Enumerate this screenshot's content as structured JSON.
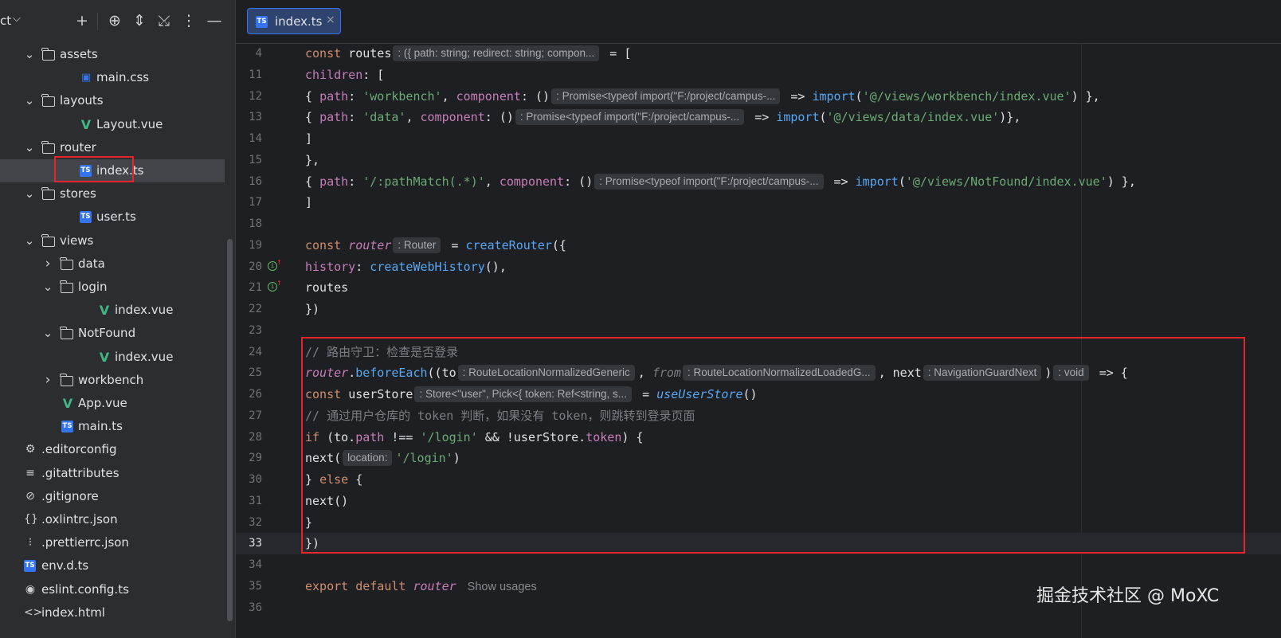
{
  "project_panel": {
    "title": "ct",
    "toolbar_icons": [
      "add-icon",
      "locate-icon",
      "expand-all-icon",
      "collapse-all-icon",
      "more-options-icon",
      "hide-icon"
    ],
    "items": [
      {
        "label": "assets",
        "kind": "folder",
        "depth": 1,
        "expanded": true
      },
      {
        "label": "main.css",
        "kind": "css",
        "depth": 2
      },
      {
        "label": "layouts",
        "kind": "folder",
        "depth": 1,
        "expanded": true
      },
      {
        "label": "Layout.vue",
        "kind": "vue",
        "depth": 2
      },
      {
        "label": "router",
        "kind": "folder",
        "depth": 1,
        "expanded": true
      },
      {
        "label": "index.ts",
        "kind": "ts",
        "depth": 2,
        "selected": true
      },
      {
        "label": "stores",
        "kind": "folder",
        "depth": 1,
        "expanded": true
      },
      {
        "label": "user.ts",
        "kind": "ts",
        "depth": 2
      },
      {
        "label": "views",
        "kind": "folder",
        "depth": 1,
        "expanded": true
      },
      {
        "label": "data",
        "kind": "folder",
        "depth": 2,
        "expanded": false
      },
      {
        "label": "login",
        "kind": "folder",
        "depth": 2,
        "expanded": true
      },
      {
        "label": "index.vue",
        "kind": "vue",
        "depth": 3
      },
      {
        "label": "NotFound",
        "kind": "folder",
        "depth": 2,
        "expanded": true
      },
      {
        "label": "index.vue",
        "kind": "vue",
        "depth": 3
      },
      {
        "label": "workbench",
        "kind": "folder",
        "depth": 2,
        "expanded": false
      },
      {
        "label": "App.vue",
        "kind": "vue",
        "depth": 1
      },
      {
        "label": "main.ts",
        "kind": "ts",
        "depth": 1
      },
      {
        "label": ".editorconfig",
        "kind": "gear",
        "depth": 0
      },
      {
        "label": ".gitattributes",
        "kind": "lines",
        "depth": 0
      },
      {
        "label": ".gitignore",
        "kind": "ignore",
        "depth": 0
      },
      {
        "label": ".oxlintrc.json",
        "kind": "json",
        "depth": 0
      },
      {
        "label": ".prettierrc.json",
        "kind": "prettier",
        "depth": 0
      },
      {
        "label": "env.d.ts",
        "kind": "ts",
        "depth": 0
      },
      {
        "label": "eslint.config.ts",
        "kind": "eslint",
        "depth": 0
      },
      {
        "label": "index.html",
        "kind": "html",
        "depth": 0
      }
    ]
  },
  "editor": {
    "tab": {
      "label": "index.ts",
      "icon": "ts-file-icon",
      "close": "×"
    },
    "current_line": "33",
    "lines": [
      {
        "n": "4",
        "tokens": [
          [
            "kw",
            "const "
          ],
          [
            "",
            "routes"
          ],
          [
            "hint",
            ": ({ path: string; redirect: string; compon..."
          ],
          [
            "",
            " = ["
          ]
        ]
      },
      {
        "n": "11",
        "tokens": [
          [
            "",
            "    "
          ],
          [
            "prop",
            "children"
          ],
          [
            "",
            ": ["
          ]
        ]
      },
      {
        "n": "12",
        "tokens": [
          [
            "",
            "      { "
          ],
          [
            "prop",
            "path"
          ],
          [
            "",
            ": "
          ],
          [
            "str",
            "'workbench'"
          ],
          [
            "",
            ", "
          ],
          [
            "prop",
            "component"
          ],
          [
            "",
            ": ()"
          ],
          [
            "hint",
            ": Promise<typeof import(\"F:/project/campus-..."
          ],
          [
            "",
            " => "
          ],
          [
            "fn",
            "import"
          ],
          [
            "",
            "("
          ],
          [
            "str",
            "'@/views/workbench/index.vue'"
          ],
          [
            "",
            ") },"
          ]
        ]
      },
      {
        "n": "13",
        "tokens": [
          [
            "",
            "      { "
          ],
          [
            "prop",
            "path"
          ],
          [
            "",
            ": "
          ],
          [
            "str",
            "'data'"
          ],
          [
            "",
            ", "
          ],
          [
            "prop",
            "component"
          ],
          [
            "",
            ": ()"
          ],
          [
            "hint",
            ": Promise<typeof import(\"F:/project/campus-..."
          ],
          [
            "",
            " => "
          ],
          [
            "fn",
            "import"
          ],
          [
            "",
            "("
          ],
          [
            "str",
            "'@/views/data/index.vue'"
          ],
          [
            "",
            ")},"
          ]
        ]
      },
      {
        "n": "14",
        "tokens": [
          [
            "",
            "    ]"
          ]
        ]
      },
      {
        "n": "15",
        "tokens": [
          [
            "",
            "  },"
          ]
        ]
      },
      {
        "n": "16",
        "tokens": [
          [
            "",
            "  { "
          ],
          [
            "prop",
            "path"
          ],
          [
            "",
            ": "
          ],
          [
            "str",
            "'/:pathMatch(.*)'"
          ],
          [
            "",
            ", "
          ],
          [
            "prop",
            "component"
          ],
          [
            "",
            ": ()"
          ],
          [
            "hint",
            ": Promise<typeof import(\"F:/project/campus-..."
          ],
          [
            "",
            " => "
          ],
          [
            "fn",
            "import"
          ],
          [
            "",
            "("
          ],
          [
            "str",
            "'@/views/NotFound/index.vue'"
          ],
          [
            "",
            ") },"
          ]
        ]
      },
      {
        "n": "17",
        "tokens": [
          [
            "",
            "]"
          ]
        ]
      },
      {
        "n": "18",
        "tokens": []
      },
      {
        "n": "19",
        "tokens": [
          [
            "kw",
            "const "
          ],
          [
            "prop it",
            "router"
          ],
          [
            "hint",
            ": Router"
          ],
          [
            "",
            " = "
          ],
          [
            "fn",
            "createRouter"
          ],
          [
            "",
            "({"
          ]
        ]
      },
      {
        "n": "20",
        "tokens": [
          [
            "",
            "  "
          ],
          [
            "prop",
            "history"
          ],
          [
            "",
            ": "
          ],
          [
            "fn",
            "createWebHistory"
          ],
          [
            "",
            "(),"
          ]
        ],
        "gutter": true
      },
      {
        "n": "21",
        "tokens": [
          [
            "",
            "  routes"
          ]
        ],
        "gutter": true
      },
      {
        "n": "22",
        "tokens": [
          [
            "",
            "})"
          ]
        ]
      },
      {
        "n": "23",
        "tokens": []
      },
      {
        "n": "24",
        "tokens": [
          [
            "cmt",
            "// 路由守卫：检查是否登录"
          ]
        ]
      },
      {
        "n": "25",
        "tokens": [
          [
            "prop it",
            "router"
          ],
          [
            "",
            "."
          ],
          [
            "fn",
            "beforeEach"
          ],
          [
            "",
            "((to"
          ],
          [
            "hint",
            ": RouteLocationNormalizedGeneric"
          ],
          [
            "",
            ", "
          ],
          [
            "par",
            "from"
          ],
          [
            "hint",
            ": RouteLocationNormalizedLoadedG..."
          ],
          [
            "",
            ", next"
          ],
          [
            "hint",
            ": NavigationGuardNext"
          ],
          [
            "",
            ")"
          ],
          [
            "hint",
            ": void"
          ],
          [
            "",
            " => {"
          ]
        ]
      },
      {
        "n": "26",
        "tokens": [
          [
            "",
            "  "
          ],
          [
            "kw",
            "const "
          ],
          [
            "",
            "userStore"
          ],
          [
            "hint",
            ": Store<\"user\", Pick<{ token: Ref<string, s..."
          ],
          [
            "",
            " = "
          ],
          [
            "itfn",
            "useUserStore"
          ],
          [
            "",
            "()"
          ]
        ]
      },
      {
        "n": "27",
        "tokens": [
          [
            "",
            "  "
          ],
          [
            "cmt",
            "// 通过用户仓库的 token 判断，如果没有 token，则跳转到登录页面"
          ]
        ]
      },
      {
        "n": "28",
        "tokens": [
          [
            "",
            "  "
          ],
          [
            "kw",
            "if "
          ],
          [
            "",
            "(to."
          ],
          [
            "prop",
            "path"
          ],
          [
            "",
            " !== "
          ],
          [
            "str",
            "'/login'"
          ],
          [
            "",
            " && !userStore."
          ],
          [
            "prop",
            "token"
          ],
          [
            "",
            ") {"
          ]
        ]
      },
      {
        "n": "29",
        "tokens": [
          [
            "",
            "    next("
          ],
          [
            "hint",
            "location:"
          ],
          [
            "str",
            "'/login'"
          ],
          [
            "",
            ")"
          ]
        ]
      },
      {
        "n": "30",
        "tokens": [
          [
            "",
            "  } "
          ],
          [
            "kw",
            "else "
          ],
          [
            "",
            "{"
          ]
        ]
      },
      {
        "n": "31",
        "tokens": [
          [
            "",
            "    next()"
          ]
        ]
      },
      {
        "n": "32",
        "tokens": [
          [
            "",
            "  }"
          ]
        ]
      },
      {
        "n": "33",
        "tokens": [
          [
            "",
            "})"
          ]
        ]
      },
      {
        "n": "34",
        "tokens": []
      },
      {
        "n": "35",
        "tokens": [
          [
            "kw",
            "export default "
          ],
          [
            "prop it",
            "router"
          ],
          [
            "usage",
            "Show usages"
          ]
        ]
      },
      {
        "n": "36",
        "tokens": []
      }
    ]
  },
  "watermark": "掘金技术社区 @ MoXC",
  "colors": {
    "highlight_box": "#e5252a",
    "accent": "#3574f0"
  }
}
